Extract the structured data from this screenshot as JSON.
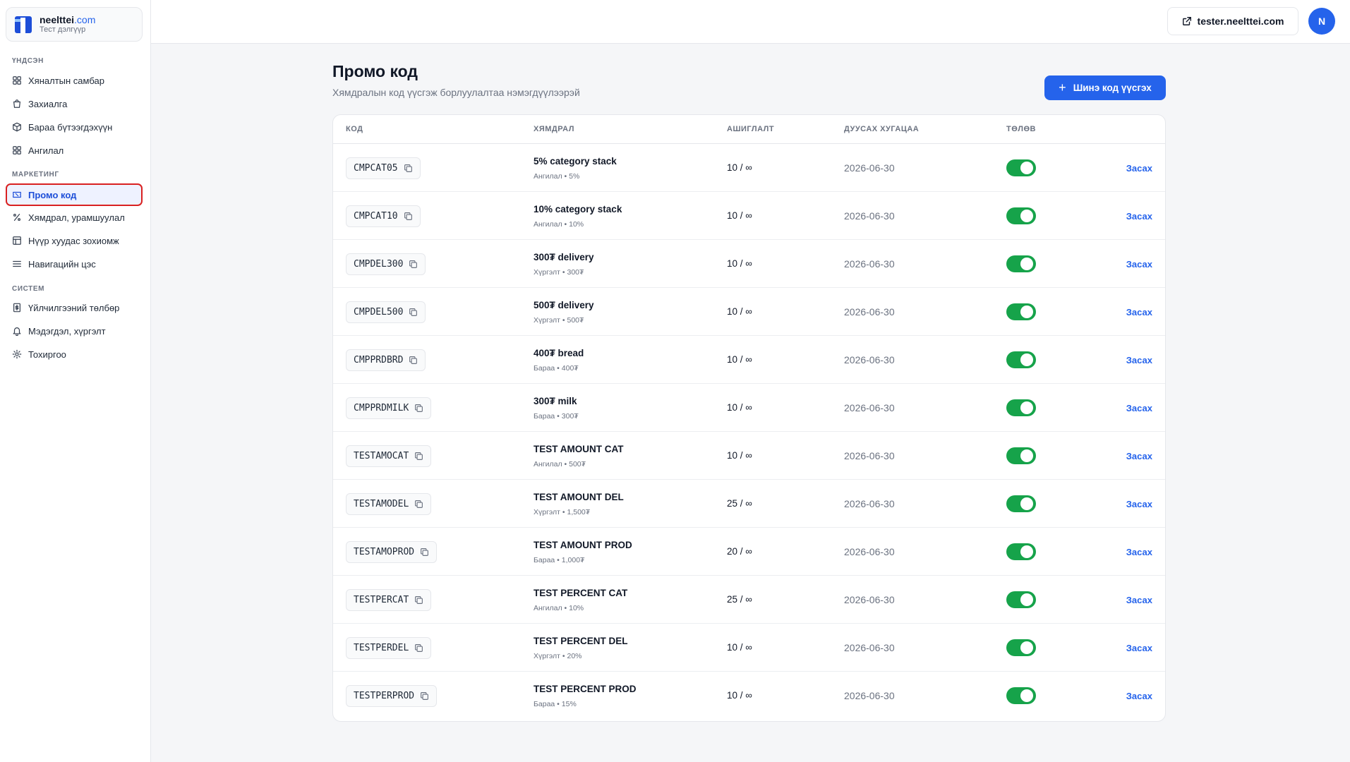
{
  "brand": {
    "name": "neelttei",
    "tld": ".com",
    "subtitle": "Тест дэлгүүр"
  },
  "sidebar": {
    "sections": [
      {
        "label": "ҮНДСЭН",
        "items": [
          {
            "label": "Хяналтын самбар",
            "icon": "dashboard-icon"
          },
          {
            "label": "Захиалга",
            "icon": "bag-icon"
          },
          {
            "label": "Бараа бүтээгдэхүүн",
            "icon": "box-icon"
          },
          {
            "label": "Ангилал",
            "icon": "grid-icon"
          }
        ]
      },
      {
        "label": "МАРКЕТИНГ",
        "items": [
          {
            "label": "Промо код",
            "icon": "ticket-icon",
            "active": true
          },
          {
            "label": "Хямдрал, урамшуулал",
            "icon": "percent-icon"
          },
          {
            "label": "Нүүр хуудас зохиомж",
            "icon": "layout-icon"
          },
          {
            "label": "Навигацийн цэс",
            "icon": "menu-icon"
          }
        ]
      },
      {
        "label": "СИСТЕМ",
        "items": [
          {
            "label": "Үйлчилгээний төлбөр",
            "icon": "invoice-icon"
          },
          {
            "label": "Мэдэгдэл, хүргэлт",
            "icon": "bell-icon"
          },
          {
            "label": "Тохиргоо",
            "icon": "gear-icon"
          }
        ]
      }
    ]
  },
  "topbar": {
    "site_link": "tester.neelttei.com",
    "avatar_initial": "N"
  },
  "header": {
    "title": "Промо код",
    "subtitle": "Хямдралын код үүсгэж борлуулалтаа нэмэгдүүлээрэй",
    "new_button": "Шинэ код үүсгэх"
  },
  "table": {
    "columns": [
      "КОД",
      "ХЯМДРАЛ",
      "АШИГЛАЛТ",
      "ДУУСАХ ХУГАЦАА",
      "ТӨЛӨВ"
    ],
    "edit_label": "Засах",
    "rows": [
      {
        "code": "CMPCAT05",
        "title": "5% category stack",
        "sub": "Ангилал • 5%",
        "usage": "10 / ∞",
        "expiry": "2026-06-30",
        "active": true
      },
      {
        "code": "CMPCAT10",
        "title": "10% category stack",
        "sub": "Ангилал • 10%",
        "usage": "10 / ∞",
        "expiry": "2026-06-30",
        "active": true
      },
      {
        "code": "CMPDEL300",
        "title": "300₮ delivery",
        "sub": "Хүргэлт • 300₮",
        "usage": "10 / ∞",
        "expiry": "2026-06-30",
        "active": true
      },
      {
        "code": "CMPDEL500",
        "title": "500₮ delivery",
        "sub": "Хүргэлт • 500₮",
        "usage": "10 / ∞",
        "expiry": "2026-06-30",
        "active": true
      },
      {
        "code": "CMPPRDBRD",
        "title": "400₮ bread",
        "sub": "Бараа • 400₮",
        "usage": "10 / ∞",
        "expiry": "2026-06-30",
        "active": true
      },
      {
        "code": "CMPPRDMILK",
        "title": "300₮ milk",
        "sub": "Бараа • 300₮",
        "usage": "10 / ∞",
        "expiry": "2026-06-30",
        "active": true
      },
      {
        "code": "TESTAMOCAT",
        "title": "TEST AMOUNT CAT",
        "sub": "Ангилал • 500₮",
        "usage": "10 / ∞",
        "expiry": "2026-06-30",
        "active": true
      },
      {
        "code": "TESTAMODEL",
        "title": "TEST AMOUNT DEL",
        "sub": "Хүргэлт • 1,500₮",
        "usage": "25 / ∞",
        "expiry": "2026-06-30",
        "active": true
      },
      {
        "code": "TESTAMOPROD",
        "title": "TEST AMOUNT PROD",
        "sub": "Бараа • 1,000₮",
        "usage": "20 / ∞",
        "expiry": "2026-06-30",
        "active": true
      },
      {
        "code": "TESTPERCAT",
        "title": "TEST PERCENT CAT",
        "sub": "Ангилал • 10%",
        "usage": "25 / ∞",
        "expiry": "2026-06-30",
        "active": true
      },
      {
        "code": "TESTPERDEL",
        "title": "TEST PERCENT DEL",
        "sub": "Хүргэлт • 20%",
        "usage": "10 / ∞",
        "expiry": "2026-06-30",
        "active": true
      },
      {
        "code": "TESTPERPROD",
        "title": "TEST PERCENT PROD",
        "sub": "Бараа • 15%",
        "usage": "10 / ∞",
        "expiry": "2026-06-30",
        "active": true
      }
    ]
  }
}
